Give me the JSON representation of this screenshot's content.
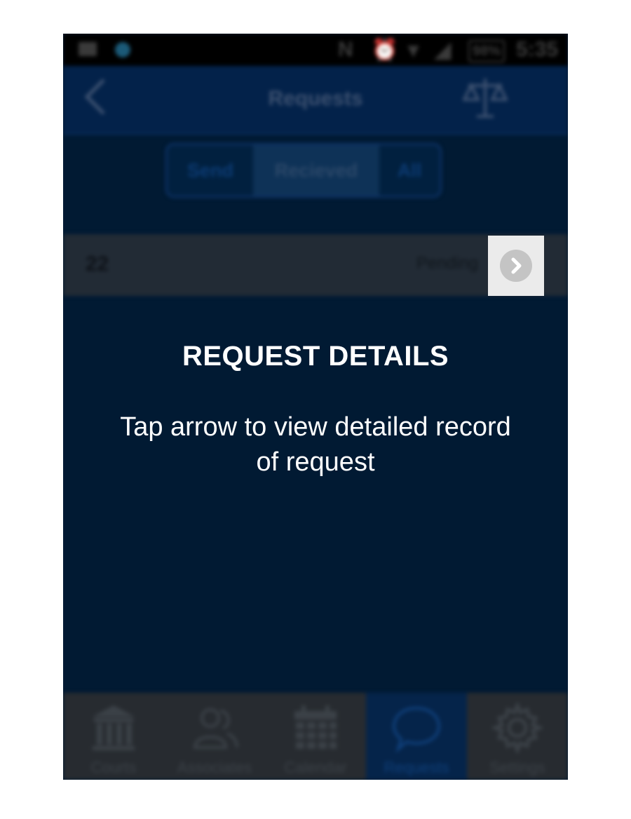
{
  "status_bar": {
    "battery": "98%",
    "time": "5:35",
    "icons": [
      "image-icon",
      "dot-icon",
      "nfc-icon",
      "alarm-icon",
      "wifi-icon",
      "signal-icon"
    ]
  },
  "header": {
    "title": "Requests",
    "back_icon": "back-chevron-icon",
    "right_icon": "scales-icon"
  },
  "segment": {
    "options": [
      "Send",
      "Recieved",
      "All"
    ],
    "selected": "Recieved"
  },
  "request_row": {
    "id": "22",
    "status": "Pending"
  },
  "tabs": [
    {
      "label": "Courts",
      "icon": "courthouse-icon"
    },
    {
      "label": "Associates",
      "icon": "people-icon"
    },
    {
      "label": "Calendar",
      "icon": "calendar-icon"
    },
    {
      "label": "Requests",
      "icon": "chat-bubble-icon"
    },
    {
      "label": "Settings",
      "icon": "gear-icon"
    }
  ],
  "active_tab": "Requests",
  "tutorial": {
    "heading": "REQUEST DETAILS",
    "body": "Tap arrow to view detailed record of request"
  },
  "colors": {
    "overlay": "#011a33",
    "highlight": "#ebebeb",
    "text": "#ffffff"
  }
}
